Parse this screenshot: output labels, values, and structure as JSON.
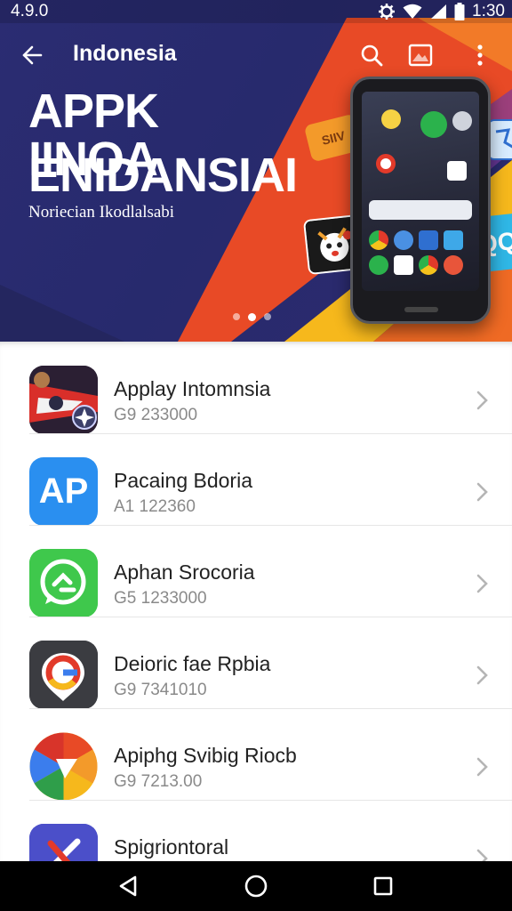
{
  "status_bar": {
    "time_left": "4.9.0",
    "time_right": "1:30",
    "icons": [
      "settings-cog-icon",
      "wifi-icon",
      "signal-icon",
      "battery-icon"
    ]
  },
  "toolbar": {
    "title": "Indonesia",
    "back_icon": "arrow-left-icon",
    "actions": [
      "search-icon",
      "image-icon",
      "more-vert-icon"
    ]
  },
  "hero": {
    "title_line1": "APPK IINOA",
    "title_line2": "ENIDANSIAI",
    "subtitle": "Noriecian Ikodlalsabi",
    "card_text_left": "SIIV",
    "card_text_right": "QQ",
    "page_indicator": {
      "count": 3,
      "active": 1
    },
    "colors": {
      "bg": "#2a2b70",
      "orange": "#f05a22",
      "yellow": "#f7b81b",
      "red": "#e63c2a"
    }
  },
  "apps": [
    {
      "title": "Applay Intomnsia",
      "subtitle": "G9 233000",
      "icon": "game-app-icon"
    },
    {
      "title": "Pacaing Bdoria",
      "subtitle": "A1 122360",
      "icon": "ap-app-icon",
      "icon_text": "AP"
    },
    {
      "title": "Aphan Srocoria",
      "subtitle": "G5 1233000",
      "icon": "chat-app-icon"
    },
    {
      "title": "Deioric fae Rpbia",
      "subtitle": "G9 7341010",
      "icon": "google-app-icon"
    },
    {
      "title": "Apiphg Svibig Riocb",
      "subtitle": "G9 7213.00",
      "icon": "chrome-like-app-icon"
    },
    {
      "title": "Spigriontoral",
      "subtitle": "",
      "icon": "tools-app-icon"
    }
  ],
  "nav_bar": {
    "buttons": [
      "back-triangle-icon",
      "home-circle-icon",
      "recents-square-icon"
    ]
  }
}
